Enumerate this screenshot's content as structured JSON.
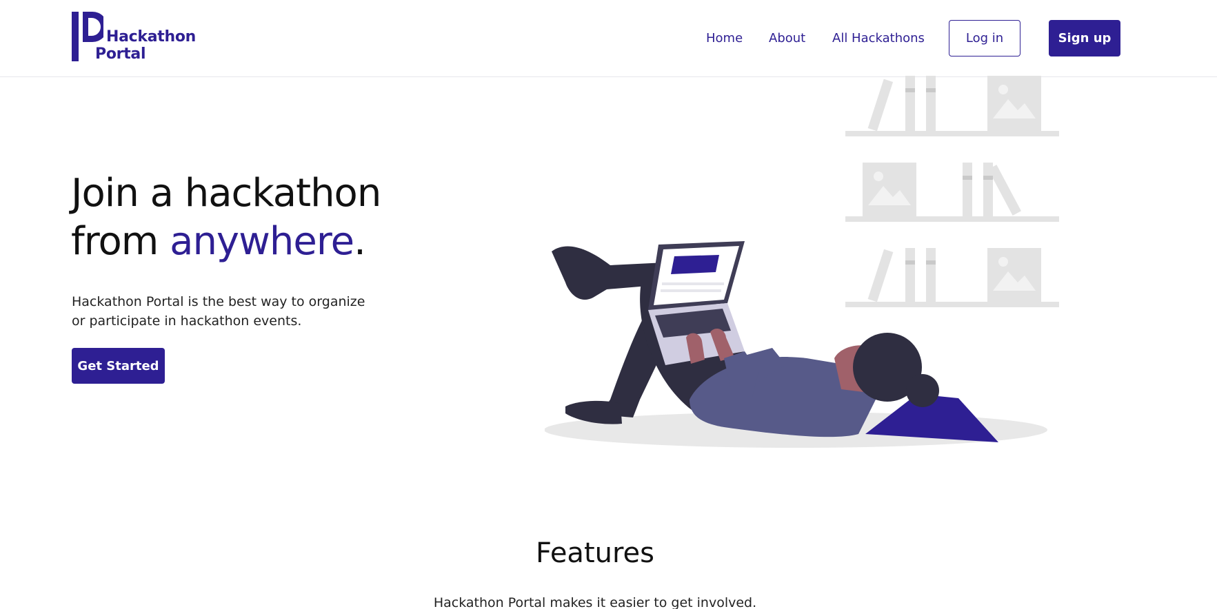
{
  "brand": {
    "line1": "Hackathon",
    "line2": "Portal",
    "color": "#2e1f93"
  },
  "nav": {
    "home": "Home",
    "about": "About",
    "all_hackathons": "All Hackathons",
    "login": "Log in",
    "signup": "Sign up"
  },
  "hero": {
    "title_line1": "Join a hackathon",
    "title_line2_prefix": "from ",
    "title_line2_accent": "anywhere",
    "title_line2_suffix": ".",
    "subtitle": "Hackathon Portal is the best way to organize or participate in hackathon events.",
    "cta": "Get Started",
    "illustration_icon": "person-with-laptop-illustration"
  },
  "features": {
    "title": "Features",
    "subtitle": "Hackathon Portal makes it easier to get involved."
  },
  "colors": {
    "accent": "#2e1f93",
    "text": "#111111",
    "shelf_gray": "#e3e3e3"
  }
}
